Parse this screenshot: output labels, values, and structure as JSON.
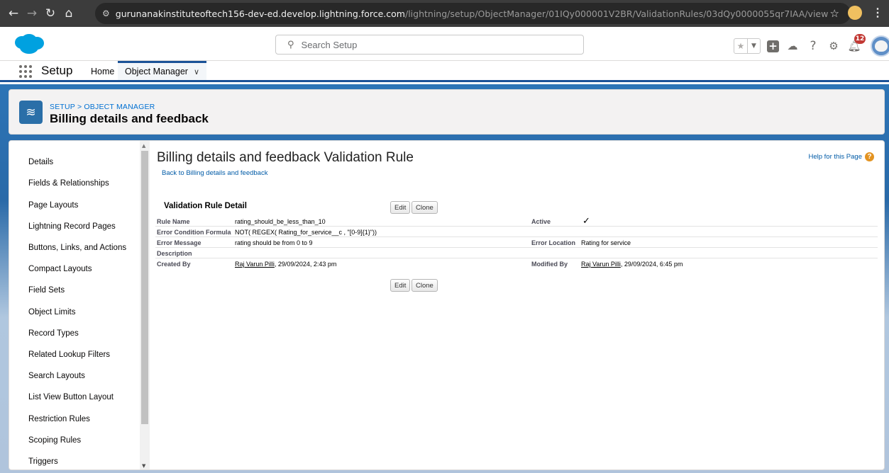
{
  "browser": {
    "url_host": "gurunanakinstituteoftech156-dev-ed.develop.lightning.force.com",
    "url_path": "/lightning/setup/ObjectManager/01IQy000001V2BR/ValidationRules/03dQy0000055qr7IAA/view"
  },
  "header": {
    "search_placeholder": "Search Setup",
    "notification_count": "12"
  },
  "nav": {
    "app_name": "Setup",
    "home": "Home",
    "object_manager": "Object Manager"
  },
  "page_header": {
    "breadcrumb_setup": "SETUP",
    "breadcrumb_sep": ">",
    "breadcrumb_om": "OBJECT MANAGER",
    "title": "Billing details and feedback"
  },
  "sidebar": {
    "items": [
      "Details",
      "Fields & Relationships",
      "Page Layouts",
      "Lightning Record Pages",
      "Buttons, Links, and Actions",
      "Compact Layouts",
      "Field Sets",
      "Object Limits",
      "Record Types",
      "Related Lookup Filters",
      "Search Layouts",
      "List View Button Layout",
      "Restriction Rules",
      "Scoping Rules",
      "Triggers"
    ]
  },
  "main": {
    "title": "Billing details and feedback Validation Rule",
    "back_link": "Back to Billing details and feedback",
    "help_link": "Help for this Page",
    "section_title": "Validation Rule Detail",
    "edit_label": "Edit",
    "clone_label": "Clone",
    "fields": {
      "rule_name_label": "Rule Name",
      "rule_name_value": "rating_should_be_less_than_10",
      "active_label": "Active",
      "active_value": "✓",
      "formula_label": "Error Condition Formula",
      "formula_value": "NOT( REGEX( Rating_for_service__c , \"[0-9]{1}\"))",
      "message_label": "Error Message",
      "message_value": "rating should be from 0 to 9",
      "location_label": "Error Location",
      "location_value": "Rating for service",
      "description_label": "Description",
      "created_by_label": "Created By",
      "created_by_name": "Raj Varun Pilli",
      "created_by_date": ", 29/09/2024, 2:43 pm",
      "modified_by_label": "Modified By",
      "modified_by_name": "Raj Varun Pilli",
      "modified_by_date": ", 29/09/2024, 6:45 pm"
    }
  }
}
